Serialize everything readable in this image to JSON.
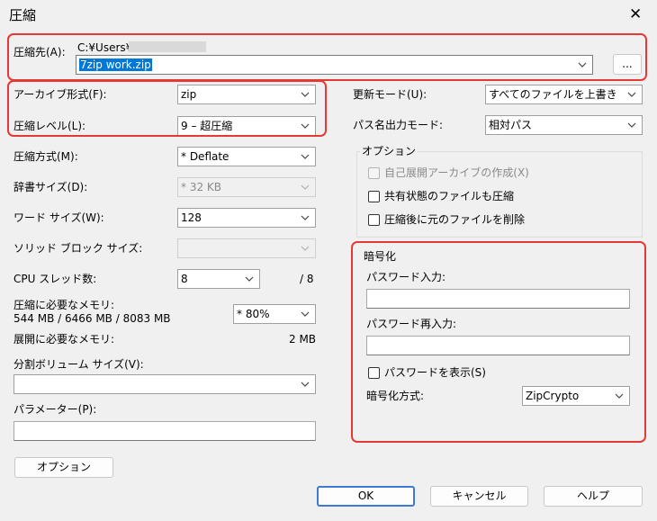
{
  "window": {
    "title": "圧縮",
    "close_glyph": "✕"
  },
  "dest": {
    "label": "圧縮先(A):",
    "path": "C:¥Users¥",
    "path_redacted": "█",
    "value": "7zip work.zip",
    "browse": "..."
  },
  "left": {
    "archive_format": {
      "label": "アーカイブ形式(F):",
      "value": "zip"
    },
    "level": {
      "label": "圧縮レベル(L):",
      "value": "9 – 超圧縮"
    },
    "method": {
      "label": "圧縮方式(M):",
      "value": "*  Deflate"
    },
    "dict": {
      "label": "辞書サイズ(D):",
      "value": "*  32 KB"
    },
    "word": {
      "label": "ワード サイズ(W):",
      "value": "128"
    },
    "solid": {
      "label": "ソリッド ブロック サイズ:",
      "value": ""
    },
    "cpu": {
      "label": "CPU スレッド数:",
      "value": "8",
      "max": "/ 8"
    },
    "mem_compress": {
      "label": "圧縮に必要なメモリ:",
      "detail": "544 MB / 6466 MB / 8083 MB",
      "value": "* 80%"
    },
    "mem_decompress": {
      "label": "展開に必要なメモリ:",
      "value": "2 MB"
    },
    "split": {
      "label": "分割ボリューム サイズ(V):",
      "value": ""
    },
    "params": {
      "label": "パラメーター(P):",
      "value": ""
    }
  },
  "right": {
    "update_mode": {
      "label": "更新モード(U):",
      "value": "すべてのファイルを上書き"
    },
    "path_mode": {
      "label": "パス名出力モード:",
      "value": "相対パス"
    },
    "options": {
      "title": "オプション",
      "sfx": "自己展開アーカイブの作成(X)",
      "shared": "共有状態のファイルも圧縮",
      "delete": "圧縮後に元のファイルを削除"
    },
    "encryption": {
      "title": "暗号化",
      "pw_label": "パスワード入力:",
      "pw2_label": "パスワード再入力:",
      "show_pw": "パスワードを表示(S)",
      "method_label": "暗号化方式:",
      "method_value": "ZipCrypto"
    }
  },
  "buttons": {
    "options": "オプション",
    "ok": "OK",
    "cancel": "キャンセル",
    "help": "ヘルプ"
  },
  "colors": {
    "highlight_box": "#e53935",
    "selection": "#0078d7",
    "default_button_border": "#3c7bd1"
  }
}
